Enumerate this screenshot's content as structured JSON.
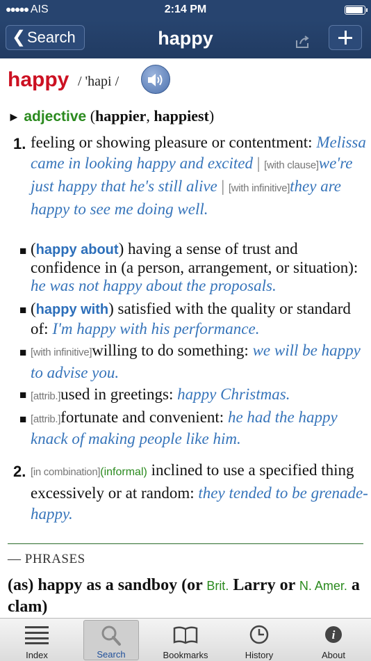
{
  "status": {
    "carrier": "AIS",
    "time": "2:14 PM"
  },
  "nav": {
    "back_label": "Search",
    "title": "happy"
  },
  "entry": {
    "headword": "happy",
    "pronunciation": "/ 'hapi /",
    "pos": "adjective",
    "forms_open": "(",
    "form1": "happier",
    "form_comma": ", ",
    "form2": "happiest",
    "forms_close": ")",
    "sense1": {
      "num": "1.",
      "def": "feeling or showing pleasure or contentment: ",
      "ex1": "Melissa came in looking happy and excited",
      "sep": " | ",
      "tag2": "[with clause]",
      "ex2": "we're just happy that he's still alive",
      "tag3": "[with infinitive]",
      "ex3": "they are happy to see me doing well."
    },
    "sub1": {
      "open": "(",
      "kw": "happy about",
      "close": ")",
      "def": " having a sense of trust and confidence in (a person, arrangement, or situation): ",
      "ex": "he was not happy about the proposals."
    },
    "sub2": {
      "open": "(",
      "kw": "happy with",
      "close": ")",
      "def": " satisfied with the quality or standard of: ",
      "ex": "I'm happy with his performance."
    },
    "sub3": {
      "tag": "[with infinitive]",
      "def": "willing to do something: ",
      "ex": "we will be happy to advise you."
    },
    "sub4": {
      "tag": "[attrib.]",
      "def": "used in greetings: ",
      "ex": "happy Christmas."
    },
    "sub5": {
      "tag": "[attrib.]",
      "def": "fortunate and convenient: ",
      "ex": "he had the happy knack of making people like him."
    },
    "sense2": {
      "num": "2.",
      "tag": "[in combination]",
      "inf": "(informal)",
      "def": " inclined to use a specified thing excessively or at random: ",
      "ex": "they tended to be grenade-happy."
    },
    "phrases_heading": "— PHRASES",
    "phrase1": {
      "a": "(as) happy as a sandboy (or ",
      "reg1": "Brit.",
      "b": " Larry or ",
      "reg2": "N. Amer.",
      "c": " a clam)"
    }
  },
  "tabs": [
    {
      "label": "Index",
      "icon": "list-icon"
    },
    {
      "label": "Search",
      "icon": "magnifier-icon"
    },
    {
      "label": "Bookmarks",
      "icon": "book-icon"
    },
    {
      "label": "History",
      "icon": "clock-icon"
    },
    {
      "label": "About",
      "icon": "info-icon"
    }
  ],
  "active_tab": "Search",
  "colors": {
    "bar": "#27446f",
    "headword": "#cc1122",
    "example": "#3674ba",
    "pos": "#2a8a1e"
  }
}
